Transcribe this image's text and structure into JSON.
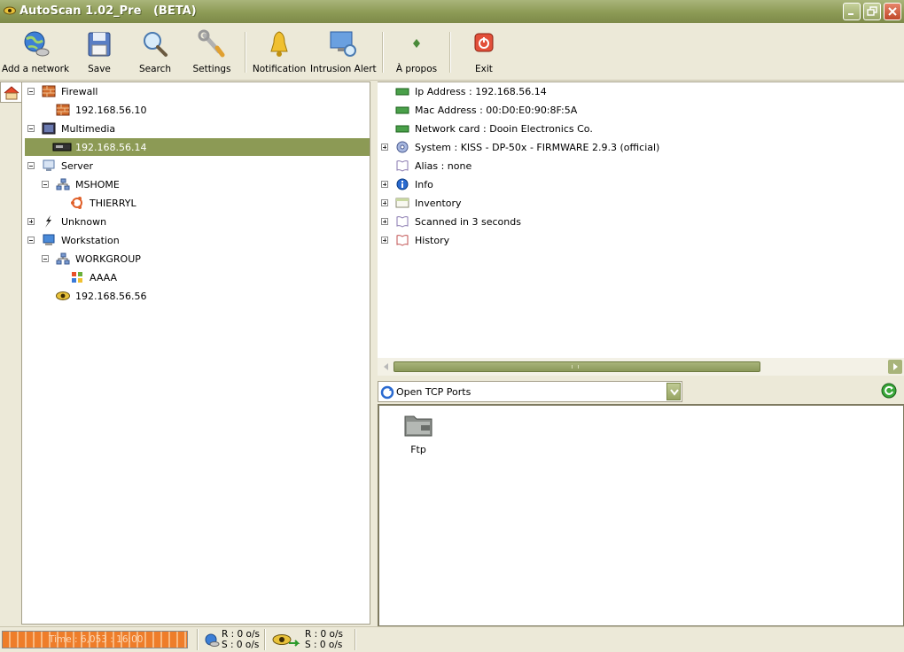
{
  "window": {
    "title": "AutoScan 1.02_Pre   (BETA)"
  },
  "toolbar": {
    "buttons": [
      {
        "label": "Add a network"
      },
      {
        "label": "Save"
      },
      {
        "label": "Search"
      },
      {
        "label": "Settings"
      },
      {
        "label": "Notification"
      },
      {
        "label": "Intrusion Alert"
      },
      {
        "label": "À propos"
      },
      {
        "label": "Exit"
      }
    ]
  },
  "tree": {
    "items": [
      {
        "label": "Firewall",
        "expanded": true
      },
      {
        "label": "192.168.56.10"
      },
      {
        "label": "Multimedia",
        "expanded": true
      },
      {
        "label": "192.168.56.14",
        "selected": true
      },
      {
        "label": "Server",
        "expanded": true
      },
      {
        "label": "MSHOME",
        "expanded": true
      },
      {
        "label": "THIERRYL"
      },
      {
        "label": "Unknown",
        "expanded": false
      },
      {
        "label": "Workstation",
        "expanded": true
      },
      {
        "label": "WORKGROUP",
        "expanded": true
      },
      {
        "label": "AAAA"
      },
      {
        "label": "192.168.56.56"
      }
    ]
  },
  "details": {
    "items": [
      {
        "label": "Ip Address : 192.168.56.14"
      },
      {
        "label": "Mac Address : 00:D0:E0:90:8F:5A"
      },
      {
        "label": "Network card : Dooin Electronics Co."
      },
      {
        "label": "System : KISS - DP-50x - FIRMWARE 2.9.3 (official)"
      },
      {
        "label": "Alias : none"
      },
      {
        "label": "Info"
      },
      {
        "label": "Inventory"
      },
      {
        "label": "Scanned in 3 seconds"
      },
      {
        "label": "History"
      }
    ]
  },
  "ports": {
    "selector": {
      "value": "Open TCP Ports"
    },
    "items": [
      {
        "label": "Ftp"
      }
    ]
  },
  "status": {
    "progress_text": "Time : 6,053 : 16:00",
    "net_in": {
      "received": "R : 0 o/s",
      "sent": "S : 0 o/s"
    },
    "net_out": {
      "received": "R : 0 o/s",
      "sent": "S : 0 o/s"
    }
  },
  "colors": {
    "accent": "#8c9a55",
    "progress": "#ee7d2a",
    "background": "#ece9d8"
  }
}
